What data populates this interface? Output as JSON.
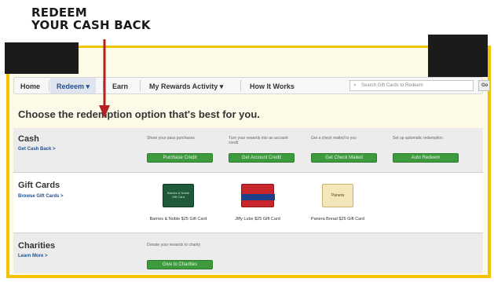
{
  "callout": {
    "line1": "REDEEM",
    "line2": "YOUR CASH BACK"
  },
  "colors": {
    "frame": "#f2c300",
    "arrow": "#b22222",
    "button": "#3d9a3d",
    "link": "#1f4f8f"
  },
  "nav": {
    "items": [
      {
        "label": "Home"
      },
      {
        "label": "Redeem ▾"
      },
      {
        "label": "Earn"
      },
      {
        "label": "My Rewards Activity ▾"
      },
      {
        "label": "How It Works"
      }
    ],
    "search_placeholder": "Search Gift Cards to Redeem",
    "go_label": "Go"
  },
  "headline": "Choose the redemption option that's best for you.",
  "cash": {
    "title": "Cash",
    "link": "Get Cash Back >",
    "options": [
      {
        "desc": "Shore your pass purchases",
        "button": "Purchase Credit"
      },
      {
        "desc": "Turn your rewards into an account credit",
        "button": "Get Account Credit"
      },
      {
        "desc": "Get a check mailed to you",
        "button": "Get Check Mailed"
      },
      {
        "desc": "Set up automatic redemption",
        "button": "Auto Redeem"
      }
    ]
  },
  "gift_cards": {
    "title": "Gift Cards",
    "link": "Browse Gift Cards >",
    "cards": [
      {
        "label": "Barnes & Noble $25 Gift Card",
        "art": "Barnes & Noble Gift Card"
      },
      {
        "label": "Jiffy Lube $25 Gift Card",
        "art": ""
      },
      {
        "label": "Panera Bread $25 Gift Card",
        "art": "Panera"
      }
    ]
  },
  "charities": {
    "title": "Charities",
    "link": "Learn More >",
    "desc": "Donate your rewards to charity",
    "button": "Give to Charities"
  }
}
